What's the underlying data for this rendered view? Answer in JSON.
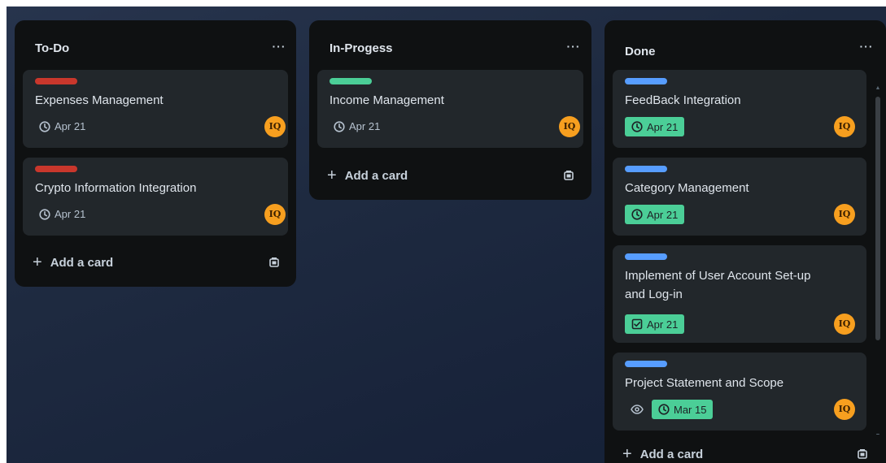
{
  "colors": {
    "label_red": "#c9372c",
    "label_green": "#4bce97",
    "label_blue": "#579dff",
    "date_done_bg": "#4bce97",
    "avatar_bg": "#f79f1f"
  },
  "lists": [
    {
      "title": "To-Do",
      "menu": "···",
      "cards": [
        {
          "label_color": "red",
          "title": "Expenses Management",
          "date": "Apr 21",
          "date_icon": "clock-icon",
          "avatar": "IQ"
        },
        {
          "label_color": "red",
          "title": "Crypto Information Integration",
          "date": "Apr 21",
          "date_icon": "clock-icon",
          "avatar": "IQ"
        }
      ],
      "add_card": "Add a card"
    },
    {
      "title": "In-Progess",
      "menu": "···",
      "cards": [
        {
          "label_color": "green",
          "title": "Income Management",
          "date": "Apr 21",
          "date_icon": "clock-icon",
          "avatar": "IQ"
        }
      ],
      "add_card": "Add a card"
    },
    {
      "title": "Done",
      "menu": "···",
      "cards": [
        {
          "label_color": "blue",
          "title": "FeedBack Integration",
          "date": "Apr 21",
          "date_icon": "clock-icon",
          "date_complete": true,
          "avatar": "IQ"
        },
        {
          "label_color": "blue",
          "title": "Category Management",
          "date": "Apr 21",
          "date_icon": "clock-icon",
          "date_complete": true,
          "avatar": "IQ"
        },
        {
          "label_color": "blue",
          "title_line1": "Implement of User Account Set-up",
          "title_line2": "and Log-in",
          "date": "Apr 21",
          "date_icon": "checkbox-icon",
          "date_complete": true,
          "avatar": "IQ"
        },
        {
          "label_color": "blue",
          "title": "Project Statement and Scope",
          "watch_icon": "eye-icon",
          "date": "Mar 15",
          "date_icon": "clock-icon",
          "date_complete": true,
          "avatar": "IQ"
        }
      ],
      "add_card": "Add a card"
    }
  ]
}
